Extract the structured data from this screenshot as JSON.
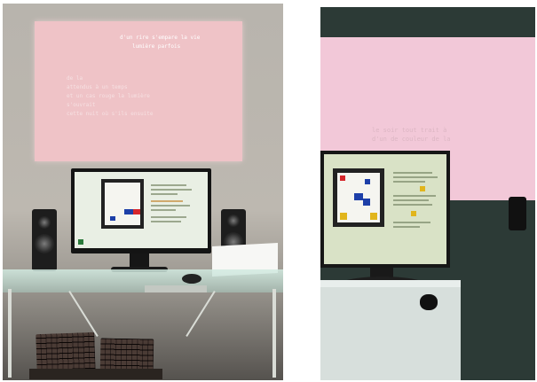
{
  "photos": [
    {
      "id": "left",
      "projection_lines_top": [
        "d'un rire s'empare la vie",
        "lumière parfois"
      ],
      "projection_lines_bottom": [
        "de la",
        "attendus à un temps",
        "et un cas rouge la lumière",
        "s'ouvrait",
        "cette nuit où s'ils ensuite"
      ],
      "colors": {
        "projection": "#efc3c7",
        "wall": "#bdb8b0"
      }
    },
    {
      "id": "right",
      "projection_lines": [
        "le soir tout trait à",
        "d'un de couleur de la"
      ],
      "colors": {
        "projection": "#f2c8d8",
        "wall": "#2c3a36"
      }
    }
  ]
}
